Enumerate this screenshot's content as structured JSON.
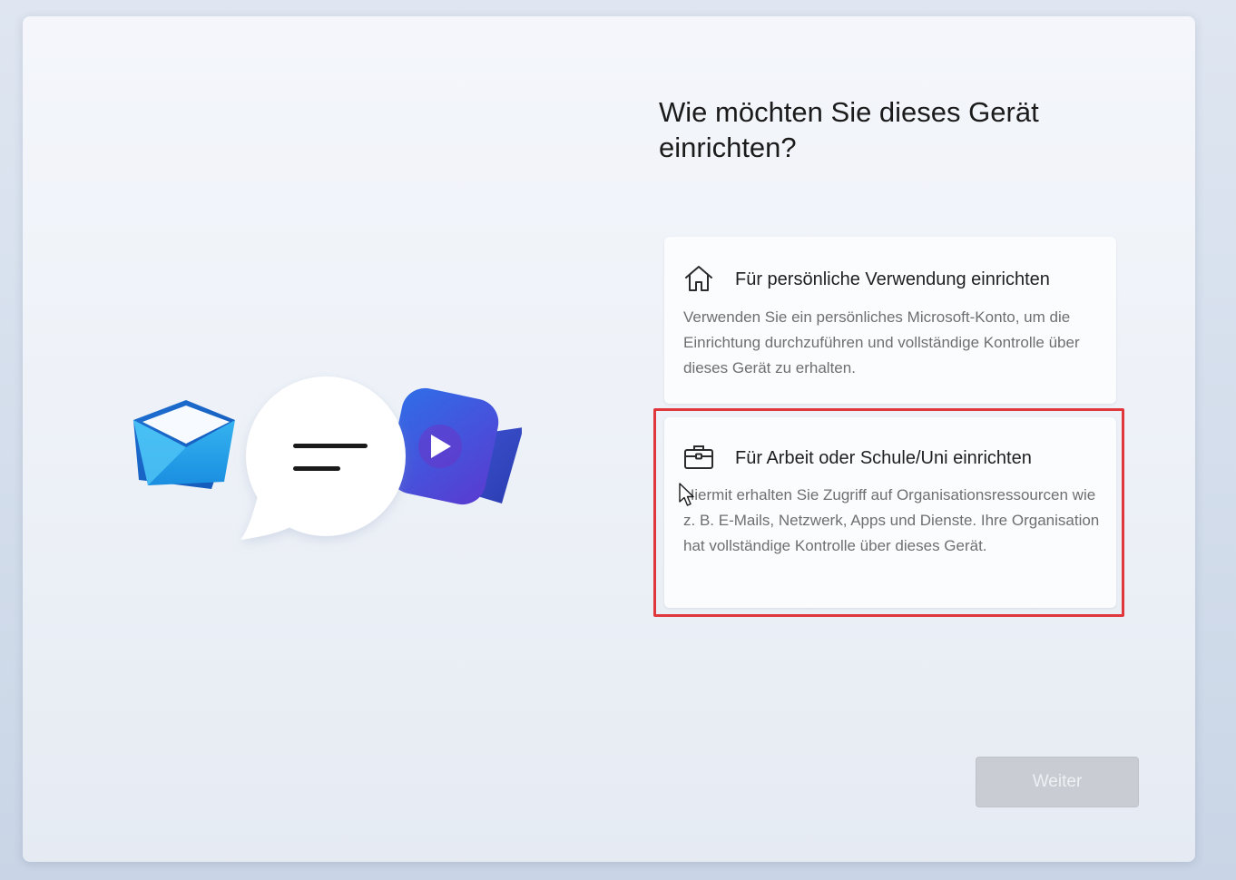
{
  "page": {
    "title": "Wie möchten Sie dieses Gerät einrichten?"
  },
  "options": [
    {
      "icon": "home-icon",
      "title": "Für persönliche Verwendung einrichten",
      "description": "Verwenden Sie ein persönliches Microsoft-Konto, um die Einrichtung durchzuführen und vollständige Kontrolle über dieses Gerät zu erhalten."
    },
    {
      "icon": "briefcase-icon",
      "title": "Für Arbeit oder Schule/Uni einrichten",
      "description": "Hiermit erhalten Sie Zugriff auf Organisationsressourcen wie z. B. E-Mails, Netzwerk, Apps und Dienste. Ihre Organisation hat vollständige Kontrolle über dieses Gerät."
    }
  ],
  "footer": {
    "next_label": "Weiter",
    "next_enabled": false
  },
  "colors": {
    "highlight": "#e0373d",
    "mail_blue": "#1f8fe0",
    "video_blue": "#3b4fd8",
    "video_purple": "#6a35c9"
  }
}
